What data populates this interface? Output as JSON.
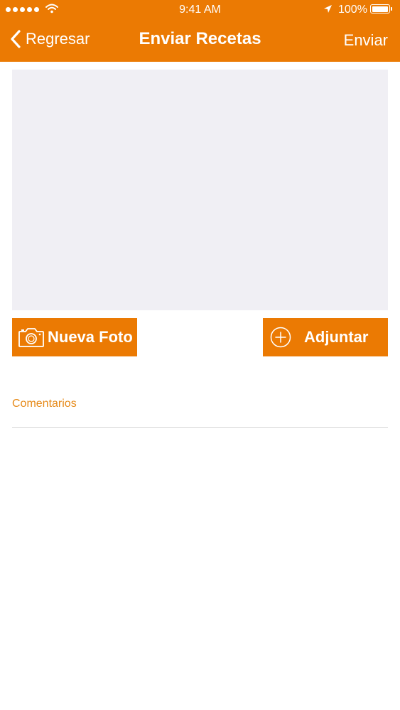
{
  "status_bar": {
    "time": "9:41 AM",
    "battery_percent": "100%",
    "battery_level": 1.0,
    "signal_bars": 5,
    "icons": [
      "signal-dots-icon",
      "wifi-icon",
      "location-arrow-icon",
      "battery-icon"
    ]
  },
  "nav": {
    "back_label": "Regresar",
    "title": "Enviar Recetas",
    "send_label": "Enviar",
    "back_icon": "chevron-left-icon"
  },
  "actions": {
    "new_photo_label": "Nueva Foto",
    "new_photo_icon": "camera-icon",
    "attach_label": "Adjuntar",
    "attach_icon": "plus-circle-icon"
  },
  "comments": {
    "placeholder": "Comentarios",
    "value": ""
  },
  "colors": {
    "accent": "#EB7A03",
    "placeholder": "#E68A19",
    "photo_area": "#F0EFF4",
    "divider": "#D6D6D6"
  }
}
